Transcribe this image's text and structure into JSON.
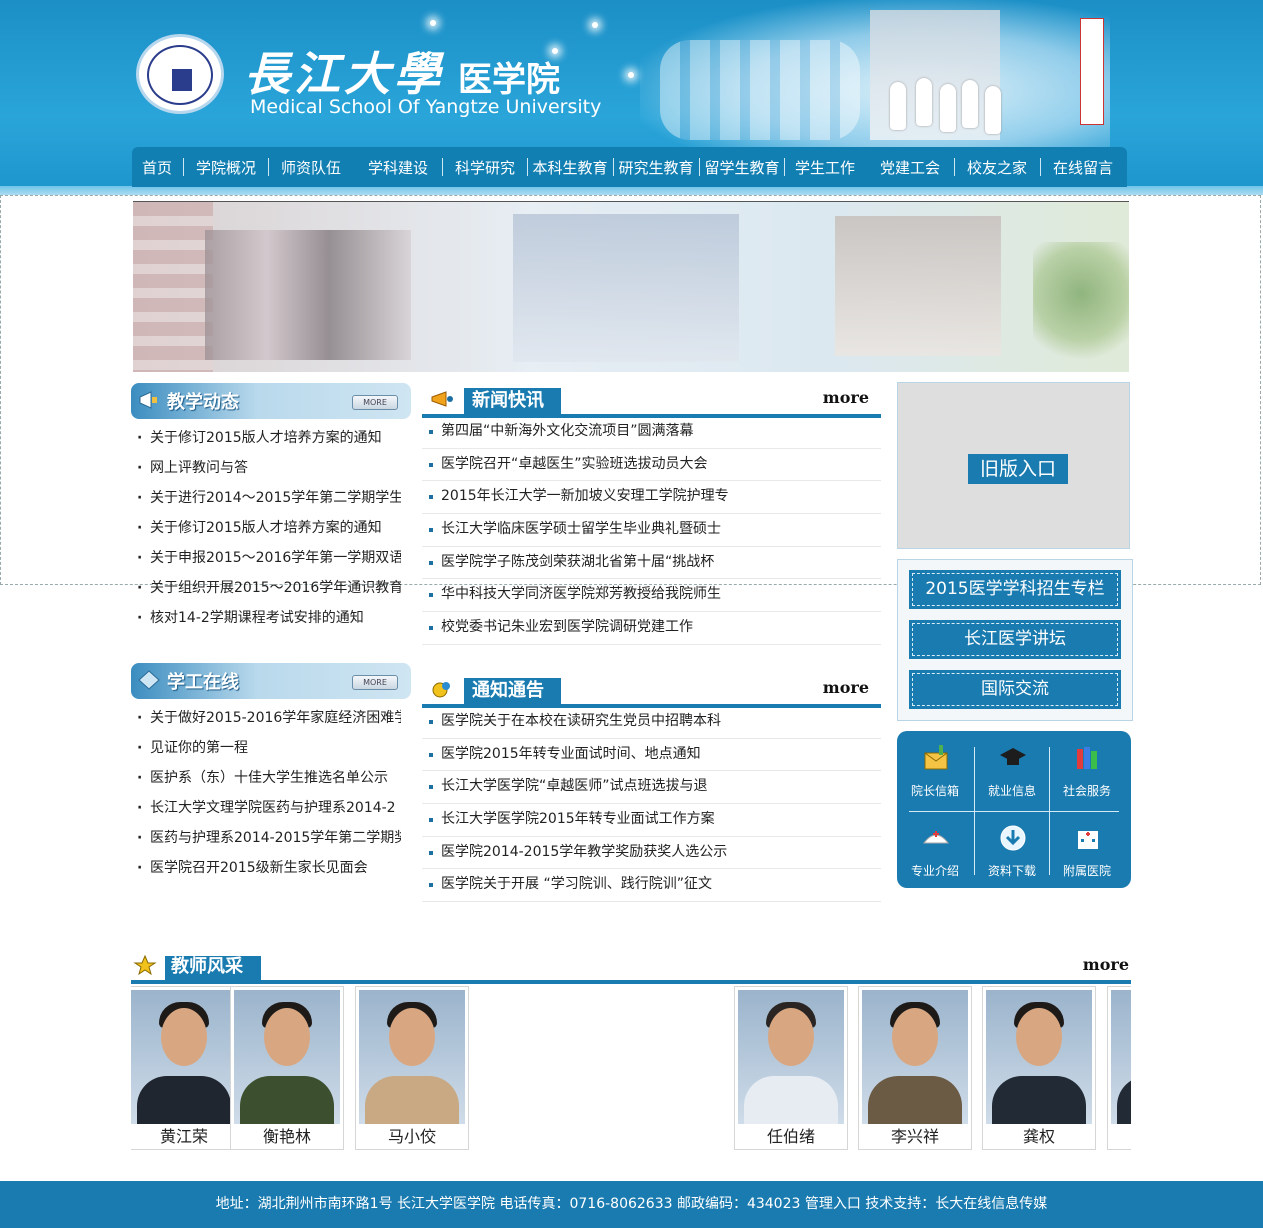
{
  "header": {
    "school_name_cn": "長江大學",
    "school_suffix_cn": "医学院",
    "school_name_en": "Medical School Of Yangtze University",
    "logo_icon": "yangtze-university-seal"
  },
  "nav": {
    "items": [
      "首页",
      "学院概况",
      "师资队伍",
      "学科建设",
      "科学研究",
      "本科生教育",
      "研究生教育",
      "留学生教育",
      "学生工作",
      "党建工会",
      "校友之家",
      "在线留言"
    ]
  },
  "teaching_news": {
    "title": "教学动态",
    "more": "MORE",
    "items": [
      "关于修订2015版人才培养方案的通知",
      "网上评教问与答",
      "关于进行2014～2015学年第二学期学生",
      "关于修订2015版人才培养方案的通知",
      "关于申报2015～2016学年第一学期双语",
      "关于组织开展2015～2016学年通识教育",
      "核对14-2学期课程考试安排的通知"
    ]
  },
  "student_work": {
    "title": "学工在线",
    "more": "MORE",
    "items": [
      "关于做好2015-2016学年家庭经济困难学",
      "见证你的第一程",
      "医护系（东）十佳大学生推选名单公示",
      "长江大学文理学院医药与护理系2014-2",
      "医药与护理系2014-2015学年第二学期奖",
      "医学院召开2015级新生家长见面会"
    ]
  },
  "news": {
    "title": "新闻快讯",
    "more": "more",
    "items": [
      "第四届“中新海外文化交流项目”圆满落幕",
      "医学院召开“卓越医生”实验班选拔动员大会",
      "2015年长江大学一新加坡义安理工学院护理专",
      "长江大学临床医学硕士留学生毕业典礼暨硕士",
      "医学院学子陈茂剑荣获湖北省第十届“挑战杯",
      "华中科技大学同济医学院郑芳教授给我院师生",
      "校党委书记朱业宏到医学院调研党建工作"
    ]
  },
  "notices": {
    "title": "通知通告",
    "more": "more",
    "items": [
      "医学院关于在本校在读研究生党员中招聘本科",
      "医学院2015年转专业面试时间、地点通知",
      "长江大学医学院“卓越医师”试点班选拔与退",
      "长江大学医学院2015年转专业面试工作方案",
      "医学院2014-2015学年教学奖励获奖人选公示",
      "医学院关于开展 “学习院训、践行院训”征文"
    ]
  },
  "right": {
    "old_version": "旧版入口",
    "links": [
      "2015医学学科招生专栏",
      "长江医学讲坛",
      "国际交流"
    ],
    "services": [
      {
        "label": "院长信箱",
        "icon": "mailbox-icon"
      },
      {
        "label": "就业信息",
        "icon": "graduation-cap-icon"
      },
      {
        "label": "社会服务",
        "icon": "books-icon"
      },
      {
        "label": "专业介绍",
        "icon": "nurse-cap-icon"
      },
      {
        "label": "资料下载",
        "icon": "download-icon"
      },
      {
        "label": "附属医院",
        "icon": "hospital-icon"
      }
    ]
  },
  "teachers": {
    "title": "教师风采",
    "more": "more",
    "people": [
      {
        "name": "黄江荣",
        "shirt": "#1f2630"
      },
      {
        "name": "衡艳林",
        "shirt": "#3c4f2e"
      },
      {
        "name": "马小佼",
        "shirt": "#c9a983"
      },
      {
        "name": "任伯绪",
        "shirt": "#e6ecf2"
      },
      {
        "name": "李兴祥",
        "shirt": "#6b5a44"
      },
      {
        "name": "龚权",
        "shirt": "#222a36"
      }
    ]
  },
  "footer": {
    "text": "地址：湖北荆州市南环路1号 长江大学医学院  电话传真：0716-8062633 邮政编码：434023  管理入口  技术支持：长大在线信息传媒"
  },
  "colors": {
    "primary": "#1a7bb0",
    "header_bg": "#2aa5d9"
  }
}
